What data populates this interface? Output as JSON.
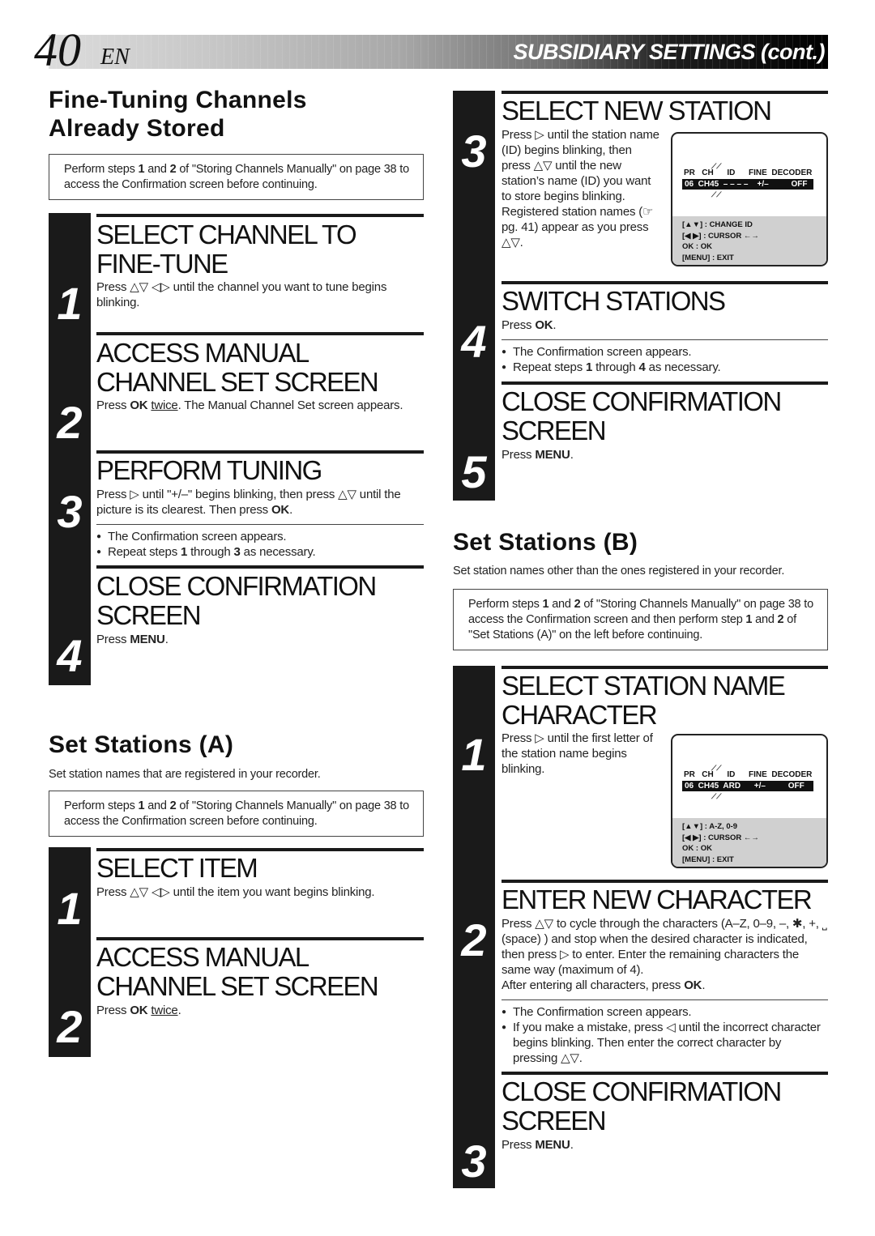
{
  "header": {
    "page_number": "40",
    "language": "EN",
    "section_title": "SUBSIDIARY SETTINGS (cont.)"
  },
  "left": {
    "fine_tuning": {
      "heading_line1": "Fine-Tuning Channels",
      "heading_line2": "Already Stored",
      "note": "Perform steps 1 and 2 of \"Storing Channels Manually\" on page 38 to access the Confirmation screen before continuing.",
      "steps": [
        {
          "num": "1",
          "title_line1": "SELECT CHANNEL TO",
          "title_line2": "FINE-TUNE",
          "text": "Press △▽ ◁▷ until the channel you want to tune begins blinking."
        },
        {
          "num": "2",
          "title_line1": "ACCESS MANUAL",
          "title_line2": "CHANNEL SET SCREEN",
          "text_pre": "Press ",
          "text_bold": "OK",
          "text_underline": "twice",
          "text_post": ". The Manual Channel Set screen appears."
        },
        {
          "num": "3",
          "title_line1": "PERFORM TUNING",
          "text_pre": "Press ▷ until \"+/–\" begins blinking, then press △▽ until the picture is its clearest. Then press ",
          "text_bold": "OK",
          "text_post": ".",
          "bullets": [
            {
              "text": "The Confirmation screen appears."
            },
            {
              "pre": "Repeat steps ",
              "b1": "1",
              "mid": " through ",
              "b2": "3",
              "post": " as necessary."
            }
          ]
        },
        {
          "num": "4",
          "title_line1": "CLOSE CONFIRMATION",
          "title_line2": "SCREEN",
          "text_pre": "Press ",
          "text_bold": "MENU",
          "text_post": "."
        }
      ]
    },
    "set_stations_a": {
      "heading": "Set Stations (A)",
      "description": "Set station names that are registered in your recorder.",
      "note": "Perform steps 1 and 2 of \"Storing Channels Manually\" on page 38 to access the Confirmation screen before continuing.",
      "steps": [
        {
          "num": "1",
          "title_line1": "SELECT ITEM",
          "text": "Press △▽ ◁▷ until the item you want begins blinking."
        },
        {
          "num": "2",
          "title_line1": "ACCESS MANUAL",
          "title_line2": "CHANNEL SET SCREEN",
          "text_pre": "Press ",
          "text_bold": "OK",
          "text_underline": "twice",
          "text_post": "."
        }
      ]
    }
  },
  "right": {
    "set_stations_a_cont": {
      "steps": [
        {
          "num": "3",
          "title_line1": "SELECT NEW STATION",
          "text": "Press ▷ until the station name (ID) begins blinking, then press △▽ until the new station’s name (ID) you want to store begins blinking.",
          "text2": "Registered station names (☞ pg. 41) appear as you press △▽."
        },
        {
          "num": "4",
          "title_line1": "SWITCH STATIONS",
          "text_pre": "Press ",
          "text_bold": "OK",
          "text_post": ".",
          "bullets": [
            {
              "text": "The Confirmation screen appears."
            },
            {
              "pre": "Repeat steps ",
              "b1": "1",
              "mid": " through ",
              "b2": "4",
              "post": " as necessary."
            }
          ]
        },
        {
          "num": "5",
          "title_line1": "CLOSE CONFIRMATION",
          "title_line2": "SCREEN",
          "text_pre": "Press ",
          "text_bold": "MENU",
          "text_post": "."
        }
      ],
      "osd": {
        "header": "PR   CH      ID      FINE  DECODER",
        "row": "06  CH45  – – – –    +/–          OFF",
        "footer": [
          "[▲▼] : CHANGE ID",
          "[◀ ▶] : CURSOR ←→",
          "OK  : OK",
          "[MENU] : EXIT"
        ]
      }
    },
    "set_stations_b": {
      "heading": "Set Stations (B)",
      "description": "Set station names other than the ones registered in your recorder.",
      "note": "Perform steps 1 and 2 of \"Storing Channels Manually\" on page 38 to access the Confirmation screen and then perform step 1 and 2 of \"Set Stations (A)\" on the left before continuing.",
      "steps": [
        {
          "num": "1",
          "title_line1": "SELECT STATION NAME",
          "title_line2": "CHARACTER",
          "text": "Press ▷ until the first letter of the station name begins blinking."
        },
        {
          "num": "2",
          "title_line1": "ENTER NEW CHARACTER",
          "text": "Press △▽ to cycle through the characters (A–Z, 0–9, –, ✱, +, ⎵ (space) ) and stop when the desired character is indicated, then press ▷ to enter. Enter the remaining characters the same way (maximum of 4).",
          "text2_pre": "After entering all characters, press ",
          "text2_bold": "OK",
          "text2_post": ".",
          "bullets": [
            {
              "text": "The Confirmation screen appears."
            },
            {
              "text": "If you make a mistake, press ◁ until the incorrect character begins blinking. Then enter the correct character by pressing △▽."
            }
          ]
        },
        {
          "num": "3",
          "title_line1": "CLOSE CONFIRMATION",
          "title_line2": "SCREEN",
          "text_pre": "Press ",
          "text_bold": "MENU",
          "text_post": "."
        }
      ],
      "osd": {
        "header": "PR   CH      ID      FINE  DECODER",
        "row": "06  CH45  ARD      +/–          OFF",
        "footer": [
          "[▲▼] : A-Z, 0-9",
          "[◀ ▶] : CURSOR ←→",
          "OK  : OK",
          "[MENU] : EXIT"
        ]
      }
    }
  }
}
